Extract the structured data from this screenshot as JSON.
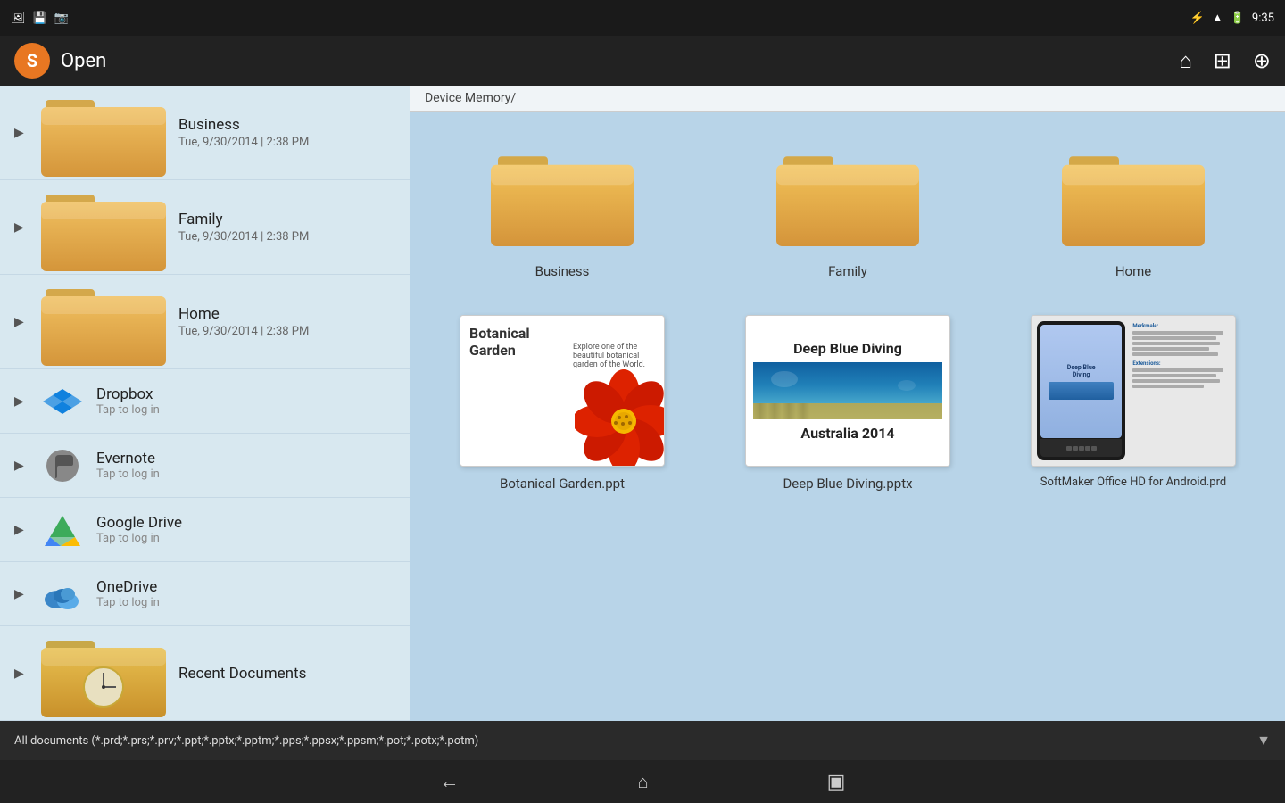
{
  "statusBar": {
    "time": "9:35",
    "icons": [
      "bluetooth",
      "wifi",
      "battery"
    ]
  },
  "titleBar": {
    "appLetter": "S",
    "title": "Open",
    "buttons": [
      "home",
      "grid",
      "new"
    ]
  },
  "sidebar": {
    "folders": [
      {
        "name": "Business",
        "date": "Tue, 9/30/2014 | 2:38 PM"
      },
      {
        "name": "Family",
        "date": "Tue, 9/30/2014 | 2:38 PM"
      },
      {
        "name": "Home",
        "date": "Tue, 9/30/2014 | 2:38 PM"
      }
    ],
    "services": [
      {
        "name": "Dropbox",
        "sub": "Tap to log in",
        "icon": "dropbox"
      },
      {
        "name": "Evernote",
        "sub": "Tap to log in",
        "icon": "evernote"
      },
      {
        "name": "Google Drive",
        "sub": "Tap to log in",
        "icon": "gdrive"
      },
      {
        "name": "OneDrive",
        "sub": "Tap to log in",
        "icon": "onedrive"
      }
    ],
    "recent": {
      "name": "Recent Documents"
    }
  },
  "breadcrumb": "Device Memory/",
  "folders": [
    {
      "label": "Business"
    },
    {
      "label": "Family"
    },
    {
      "label": "Home"
    }
  ],
  "files": [
    {
      "name": "Botanical Garden.ppt",
      "type": "botanical"
    },
    {
      "name": "Deep Blue Diving.pptx",
      "type": "deepblue"
    },
    {
      "name": "SoftMaker Office HD for Android.prd",
      "type": "softmaker"
    }
  ],
  "filterBar": "All documents (*.prd;*.prs;*.prv;*.ppt;*.pptx;*.pptm;*.pps;*.ppsx;*.ppsm;*.pot;*.potx;*.potm)",
  "navBar": {
    "back": "←",
    "home": "⌂",
    "recents": "▣"
  },
  "deepBlueContent": {
    "title1": "Deep Blue Diving",
    "title2": "Australia 2014"
  },
  "botanicalContent": {
    "title": "Botanical Garden",
    "subtitle": "Explore one of the beautiful botanical garden of the World."
  },
  "softmakerContent": {
    "title": "SoftMaker Office HD for Android"
  }
}
